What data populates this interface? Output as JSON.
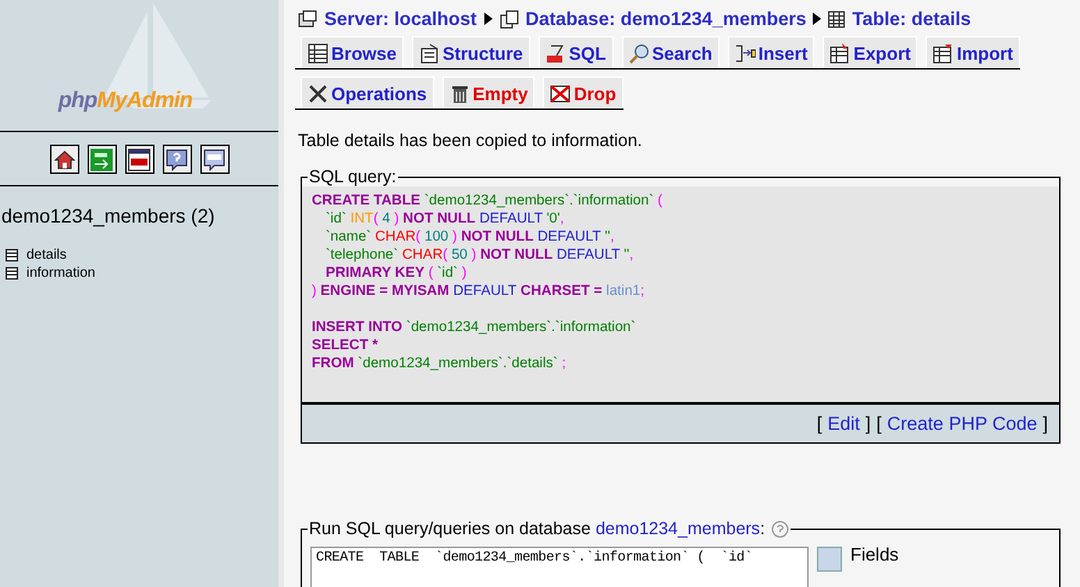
{
  "sidebar": {
    "logo_parts": [
      "php",
      "MyAdmin"
    ],
    "toolbar": [
      {
        "kind": "home"
      },
      {
        "kind": "exit"
      },
      {
        "kind": "sql-window"
      },
      {
        "kind": "help"
      },
      {
        "kind": "sql-query"
      }
    ],
    "database": "demo1234_members (2)",
    "tables": [
      {
        "name": "details"
      },
      {
        "name": "information"
      }
    ]
  },
  "breadcrumb": [
    {
      "kind": "server",
      "label": "Server: localhost"
    },
    {
      "kind": "database",
      "label": "Database: demo1234_members"
    },
    {
      "kind": "table",
      "label": "Table: details"
    }
  ],
  "tab_rows": [
    [
      {
        "label": "Browse",
        "kind": "browse",
        "danger": false,
        "selected": false
      },
      {
        "label": "Structure",
        "kind": "structure",
        "danger": false,
        "selected": false
      },
      {
        "label": "SQL",
        "kind": "sql",
        "danger": false,
        "selected": false
      },
      {
        "label": "Search",
        "kind": "search",
        "danger": false,
        "selected": false
      },
      {
        "label": "Insert",
        "kind": "insert",
        "danger": false,
        "selected": false
      },
      {
        "label": "Export",
        "kind": "export",
        "danger": false,
        "selected": false
      },
      {
        "label": "Import",
        "kind": "import",
        "danger": false,
        "selected": false
      }
    ],
    [
      {
        "label": "Operations",
        "kind": "operations",
        "danger": false,
        "selected": false
      },
      {
        "label": "Empty",
        "kind": "empty",
        "danger": true,
        "selected": false
      },
      {
        "label": "Drop",
        "kind": "drop",
        "danger": true,
        "selected": false
      }
    ]
  ],
  "message": "Table details has been copied to information.",
  "sql_query": {
    "legend": "SQL query:",
    "statements": [
      [
        {
          "indent": false,
          "tokens": [
            {
              "kind": "keyword",
              "text": "CREATE TABLE"
            },
            {
              "kind": "string",
              "text": " `demo1234_members`.`information`"
            },
            {
              "kind": "punct",
              "text": " ("
            }
          ]
        },
        {
          "indent": true,
          "tokens": [
            {
              "kind": "string",
              "text": "`id`"
            },
            {
              "kind": "type",
              "text": " INT"
            },
            {
              "kind": "punct",
              "text": "( "
            },
            {
              "kind": "number",
              "text": "4"
            },
            {
              "kind": "punct",
              "text": " )"
            },
            {
              "kind": "keyword",
              "text": " NOT NULL"
            },
            {
              "kind": "reserved",
              "text": " DEFAULT"
            },
            {
              "kind": "string",
              "text": " '0'"
            },
            {
              "kind": "punct",
              "text": ","
            }
          ]
        },
        {
          "indent": true,
          "tokens": [
            {
              "kind": "string",
              "text": "`name`"
            },
            {
              "kind": "function",
              "text": " CHAR"
            },
            {
              "kind": "punct",
              "text": "( "
            },
            {
              "kind": "number",
              "text": "100"
            },
            {
              "kind": "punct",
              "text": " )"
            },
            {
              "kind": "keyword",
              "text": " NOT NULL"
            },
            {
              "kind": "reserved",
              "text": " DEFAULT"
            },
            {
              "kind": "string",
              "text": " ''"
            },
            {
              "kind": "punct",
              "text": ","
            }
          ]
        },
        {
          "indent": true,
          "tokens": [
            {
              "kind": "string",
              "text": "`telephone`"
            },
            {
              "kind": "function",
              "text": " CHAR"
            },
            {
              "kind": "punct",
              "text": "( "
            },
            {
              "kind": "number",
              "text": "50"
            },
            {
              "kind": "punct",
              "text": " )"
            },
            {
              "kind": "keyword",
              "text": " NOT NULL"
            },
            {
              "kind": "reserved",
              "text": " DEFAULT"
            },
            {
              "kind": "string",
              "text": " ''"
            },
            {
              "kind": "punct",
              "text": ","
            }
          ]
        },
        {
          "indent": true,
          "tokens": [
            {
              "kind": "keyword",
              "text": "PRIMARY KEY"
            },
            {
              "kind": "punct",
              "text": " ( "
            },
            {
              "kind": "string",
              "text": "`id`"
            },
            {
              "kind": "punct",
              "text": " )"
            }
          ]
        },
        {
          "indent": false,
          "tokens": [
            {
              "kind": "punct",
              "text": ")"
            },
            {
              "kind": "keyword",
              "text": " ENGINE = MYISAM"
            },
            {
              "kind": "reserved",
              "text": " DEFAULT"
            },
            {
              "kind": "keyword",
              "text": " CHARSET ="
            },
            {
              "kind": "value",
              "text": " latin1"
            },
            {
              "kind": "punct",
              "text": ";"
            }
          ]
        }
      ],
      [
        {
          "indent": false,
          "tokens": [
            {
              "kind": "keyword",
              "text": "INSERT INTO"
            },
            {
              "kind": "string",
              "text": " `demo1234_members`.`information`"
            }
          ]
        },
        {
          "indent": false,
          "tokens": [
            {
              "kind": "keyword",
              "text": "SELECT *"
            }
          ]
        },
        {
          "indent": false,
          "tokens": [
            {
              "kind": "keyword",
              "text": "FROM"
            },
            {
              "kind": "string",
              "text": " `demo1234_members`.`details`"
            },
            {
              "kind": "punct",
              "text": " ;"
            }
          ]
        }
      ]
    ],
    "links": [
      {
        "open": "[",
        "label": "Edit",
        "close": "]"
      },
      {
        "open": "[",
        "label": "Create PHP Code",
        "close": "]"
      }
    ]
  },
  "run_sql": {
    "legend_text": "Run SQL query/queries on database",
    "database_link": "demo1234_members",
    "legend_suffix": ":",
    "query": "CREATE  TABLE  `demo1234_members`.`information` (  `id`",
    "fields_label": "Fields"
  }
}
